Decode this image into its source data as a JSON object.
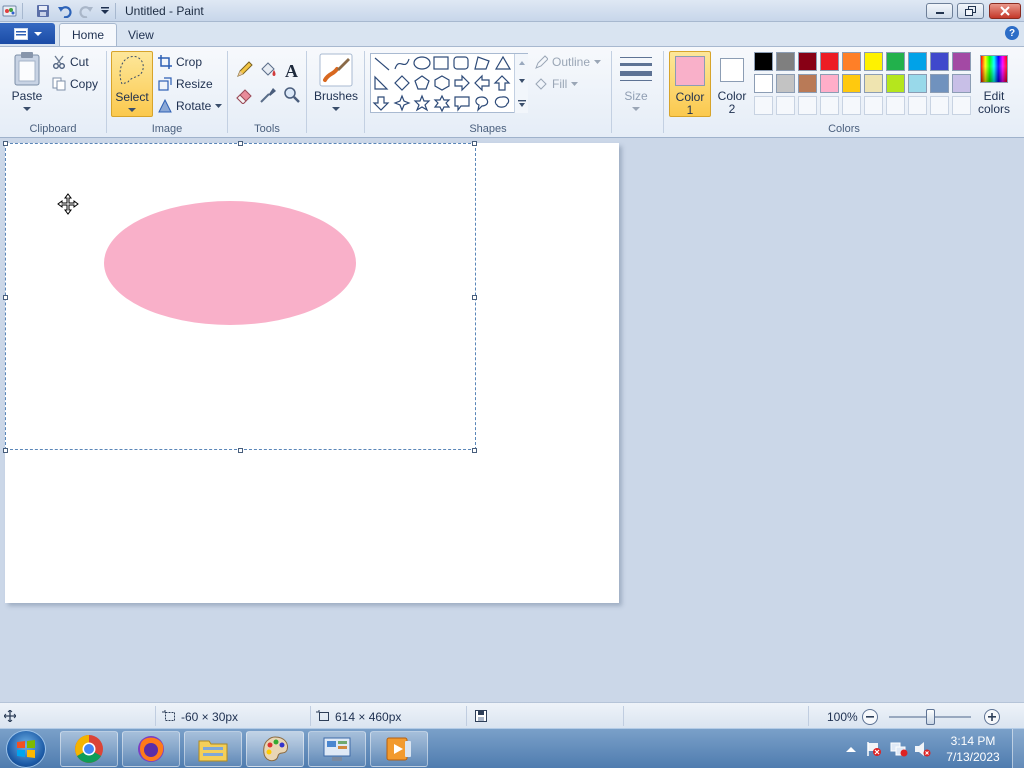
{
  "window": {
    "title": "Untitled - Paint"
  },
  "tabs": [
    {
      "label": "Home"
    },
    {
      "label": "View"
    }
  ],
  "clipboard": {
    "paste": "Paste",
    "cut": "Cut",
    "copy": "Copy",
    "group": "Clipboard"
  },
  "image": {
    "select": "Select",
    "crop": "Crop",
    "resize": "Resize",
    "rotate": "Rotate",
    "group": "Image"
  },
  "tools": {
    "group": "Tools"
  },
  "brushes": {
    "label": "Brushes"
  },
  "shapes": {
    "outline": "Outline",
    "fill": "Fill",
    "group": "Shapes"
  },
  "size": {
    "label": "Size"
  },
  "colors": {
    "color1_label": "Color",
    "color1_num": "1",
    "color2_label": "Color",
    "color2_num": "2",
    "edit_label": "Edit",
    "edit_label2": "colors",
    "group": "Colors",
    "color1": "#f9b0c9",
    "color2": "#ffffff",
    "palette_row1": [
      "#000000",
      "#7f7f7f",
      "#880015",
      "#ed1c24",
      "#ff7f27",
      "#fff200",
      "#22b14c",
      "#00a2e8",
      "#3f48cc",
      "#a349a4"
    ],
    "palette_row2": [
      "#ffffff",
      "#c3c3c3",
      "#b97a57",
      "#ffaec9",
      "#ffc90e",
      "#efe4b0",
      "#b5e61d",
      "#99d9ea",
      "#7092be",
      "#c8bfe7"
    ]
  },
  "canvas": {
    "ellipse_color": "#f9b0c9"
  },
  "status": {
    "selection_size": "-60 × 30px",
    "canvas_size": "614 × 460px",
    "zoom": "100%",
    "zoom_level": 0.5
  },
  "taskbar": {
    "time": "3:14 PM",
    "date": "7/13/2023"
  }
}
